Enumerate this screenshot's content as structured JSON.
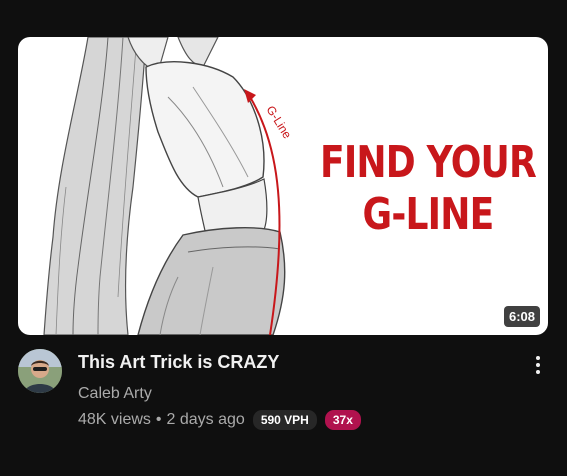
{
  "video": {
    "thumbnail_text_line1": "FIND YOUR",
    "thumbnail_text_line2": "G-LINE",
    "thumbnail_annotation": "G-Line",
    "duration": "6:08",
    "title": "This Art Trick is CRAZY",
    "channel": "Caleb Arty",
    "views": "48K views",
    "age": "2 days ago",
    "separator": "•",
    "vph_badge": "590 VPH",
    "multiplier_badge": "37x"
  },
  "colors": {
    "background": "#0f0f0f",
    "thumbnail_text": "#c8171b",
    "multiplier_badge": "#b0124e"
  },
  "icons": {
    "menu": "more-vert-icon"
  }
}
